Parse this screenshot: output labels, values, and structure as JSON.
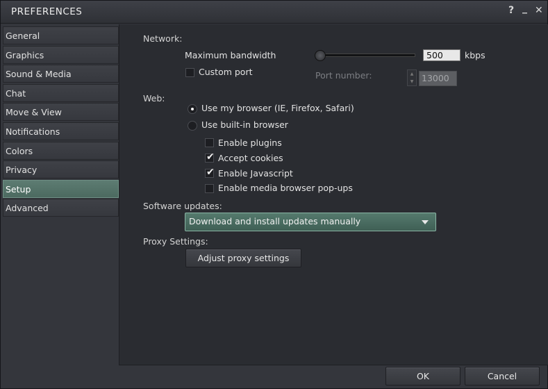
{
  "window": {
    "title": "PREFERENCES",
    "help_icon": "?",
    "minimize_icon": "_",
    "close_icon": "✕"
  },
  "sidebar": {
    "items": [
      {
        "label": "General",
        "active": false
      },
      {
        "label": "Graphics",
        "active": false
      },
      {
        "label": "Sound & Media",
        "active": false
      },
      {
        "label": "Chat",
        "active": false
      },
      {
        "label": "Move & View",
        "active": false
      },
      {
        "label": "Notifications",
        "active": false
      },
      {
        "label": "Colors",
        "active": false
      },
      {
        "label": "Privacy",
        "active": false
      },
      {
        "label": "Setup",
        "active": true
      },
      {
        "label": "Advanced",
        "active": false
      }
    ]
  },
  "network": {
    "section_label": "Network:",
    "bandwidth_label": "Maximum bandwidth",
    "bandwidth_value": "500",
    "bandwidth_unit": "kbps",
    "custom_port_label": "Custom port",
    "custom_port_checked": false,
    "port_number_label": "Port number:",
    "port_number_value": "13000"
  },
  "web": {
    "section_label": "Web:",
    "radio_my_browser": "Use my browser (IE, Firefox, Safari)",
    "radio_builtin_browser": "Use built-in browser",
    "selected": "my_browser",
    "enable_plugins": "Enable plugins",
    "enable_plugins_checked": false,
    "accept_cookies": "Accept cookies",
    "accept_cookies_checked": true,
    "enable_javascript": "Enable Javascript",
    "enable_javascript_checked": true,
    "enable_popups": "Enable media browser pop-ups",
    "enable_popups_checked": false
  },
  "software_updates": {
    "section_label": "Software updates:",
    "selected": "Download and install updates manually"
  },
  "proxy": {
    "section_label": "Proxy Settings:",
    "button_label": "Adjust proxy settings"
  },
  "footer": {
    "ok_label": "OK",
    "cancel_label": "Cancel"
  },
  "colors": {
    "accent": "#557a6d",
    "active_item": "#5d7c72",
    "panel": "#2a2c31"
  }
}
